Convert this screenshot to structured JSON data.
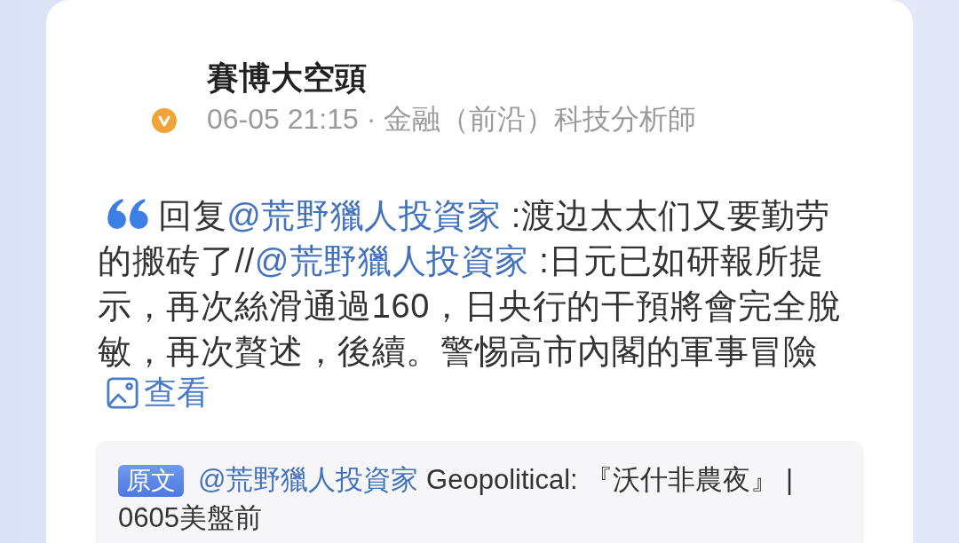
{
  "post": {
    "author": {
      "name": "賽博大空頭",
      "verified": true
    },
    "meta": "06-05 21:15 · 金融（前沿）科技分析師",
    "body": [
      {
        "kind": "text",
        "text": "回复"
      },
      {
        "kind": "mention",
        "text": "@荒野獵人投資家"
      },
      {
        "kind": "text",
        "text": " :渡边太太们又要勤劳的搬砖了//"
      },
      {
        "kind": "mention",
        "text": "@荒野獵人投資家"
      },
      {
        "kind": "text",
        "text": " :日元已如研報所提示，再次絲滑通過160，日央行的干預將會完全脫敏，再次贅述，後續。警惕高市內閣的軍事冒險"
      }
    ],
    "view_link": "查看",
    "original": {
      "tag": "原文",
      "segments": [
        {
          "kind": "mention",
          "text": "@荒野獵人投資家"
        },
        {
          "kind": "text",
          "text": " Geopolitical: 『沃什非農夜』 | 0605美盤前"
        }
      ]
    }
  }
}
